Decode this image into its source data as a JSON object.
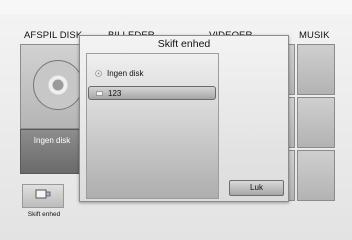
{
  "tabs": {
    "disk": "AFSPIL DISK",
    "images": "BILLEDER",
    "videos": "VIDEOER",
    "music": "MUSIK"
  },
  "disk_tile": {
    "label": "Ingen disk"
  },
  "bottom": {
    "change_device_label": "Skift enhed"
  },
  "dialog": {
    "title": "Skift enhed",
    "devices": [
      {
        "label": "Ingen disk",
        "icon": "disc-icon",
        "selected": false
      },
      {
        "label": "123",
        "icon": "usb-icon",
        "selected": true
      }
    ],
    "close_label": "Luk"
  },
  "colors": {
    "background": "#eeeeee",
    "tile_dark": "#6a6a6a",
    "dialog_border": "#8c8c8c"
  }
}
